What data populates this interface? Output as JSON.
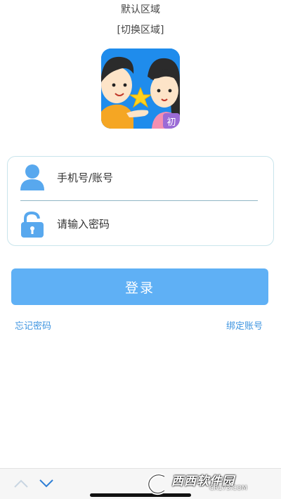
{
  "header": {
    "region_title": "默认区域",
    "region_switch": "[切换区域]"
  },
  "logo": {
    "badge_text": "初",
    "icon": "app-logo-kids-star"
  },
  "form": {
    "username_placeholder": "手机号/账号",
    "password_placeholder": "请输入密码",
    "username_icon": "user-icon",
    "password_icon": "lock-icon"
  },
  "actions": {
    "login_label": "登录",
    "forgot_password": "忘记密码",
    "bind_account": "绑定账号"
  },
  "bottom_bar": {
    "up_icon": "chevron-up-icon",
    "down_icon": "chevron-down-icon"
  },
  "watermark": {
    "main": "西西软件园",
    "sub": "CR173.COM"
  },
  "colors": {
    "accent": "#5fb0f5",
    "link": "#3f95e0",
    "icon": "#58a8ee",
    "border": "#c9e5ec"
  }
}
